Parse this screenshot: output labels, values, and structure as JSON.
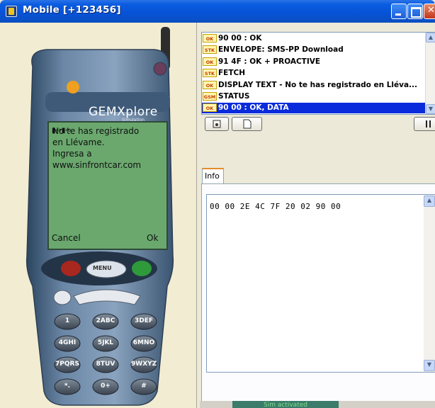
{
  "window": {
    "title": "Mobile [+123456]"
  },
  "phone": {
    "brand_logo": "GEMXplore",
    "brand_sub": "Simulation",
    "screen_lines": [
      "No te has registrado",
      "en Llévame.",
      "Ingresa a",
      "www.sinfrontcar.com"
    ],
    "softkey_left": "Cancel",
    "softkey_right": "Ok",
    "menu_label": "MENU",
    "keys": [
      "1",
      "2ABC",
      "3DEF",
      "4GHI",
      "5JKL",
      "6MNO",
      "7PQRS",
      "8TUV",
      "9WXYZ",
      "*.",
      "0+",
      "#"
    ]
  },
  "log": {
    "rows": [
      {
        "tag": "OK",
        "text": "90 00  : OK"
      },
      {
        "tag": "STK",
        "text": "ENVELOPE: SMS-PP Download"
      },
      {
        "tag": "OK",
        "text": "91 4F  : OK + PROACTIVE"
      },
      {
        "tag": "STK",
        "text": "FETCH"
      },
      {
        "tag": "OK",
        "text": "DISPLAY TEXT - No te has registrado en Lléva..."
      },
      {
        "tag": "GSM",
        "text": "STATUS"
      },
      {
        "tag": "OK",
        "text": "90 00  : OK, DATA"
      }
    ],
    "selected_index": 6
  },
  "tabs": {
    "info_label": "Info"
  },
  "info": {
    "hex": "00 00 2E 4C 7F 20 02 90 00"
  },
  "statusbar": {
    "status_text": "Sim activated"
  },
  "colors": {
    "title_bar": "#0752d6",
    "selection": "#0a2bdc",
    "phone_screen": "#6aa86e",
    "tag_text": "#c43b00"
  }
}
